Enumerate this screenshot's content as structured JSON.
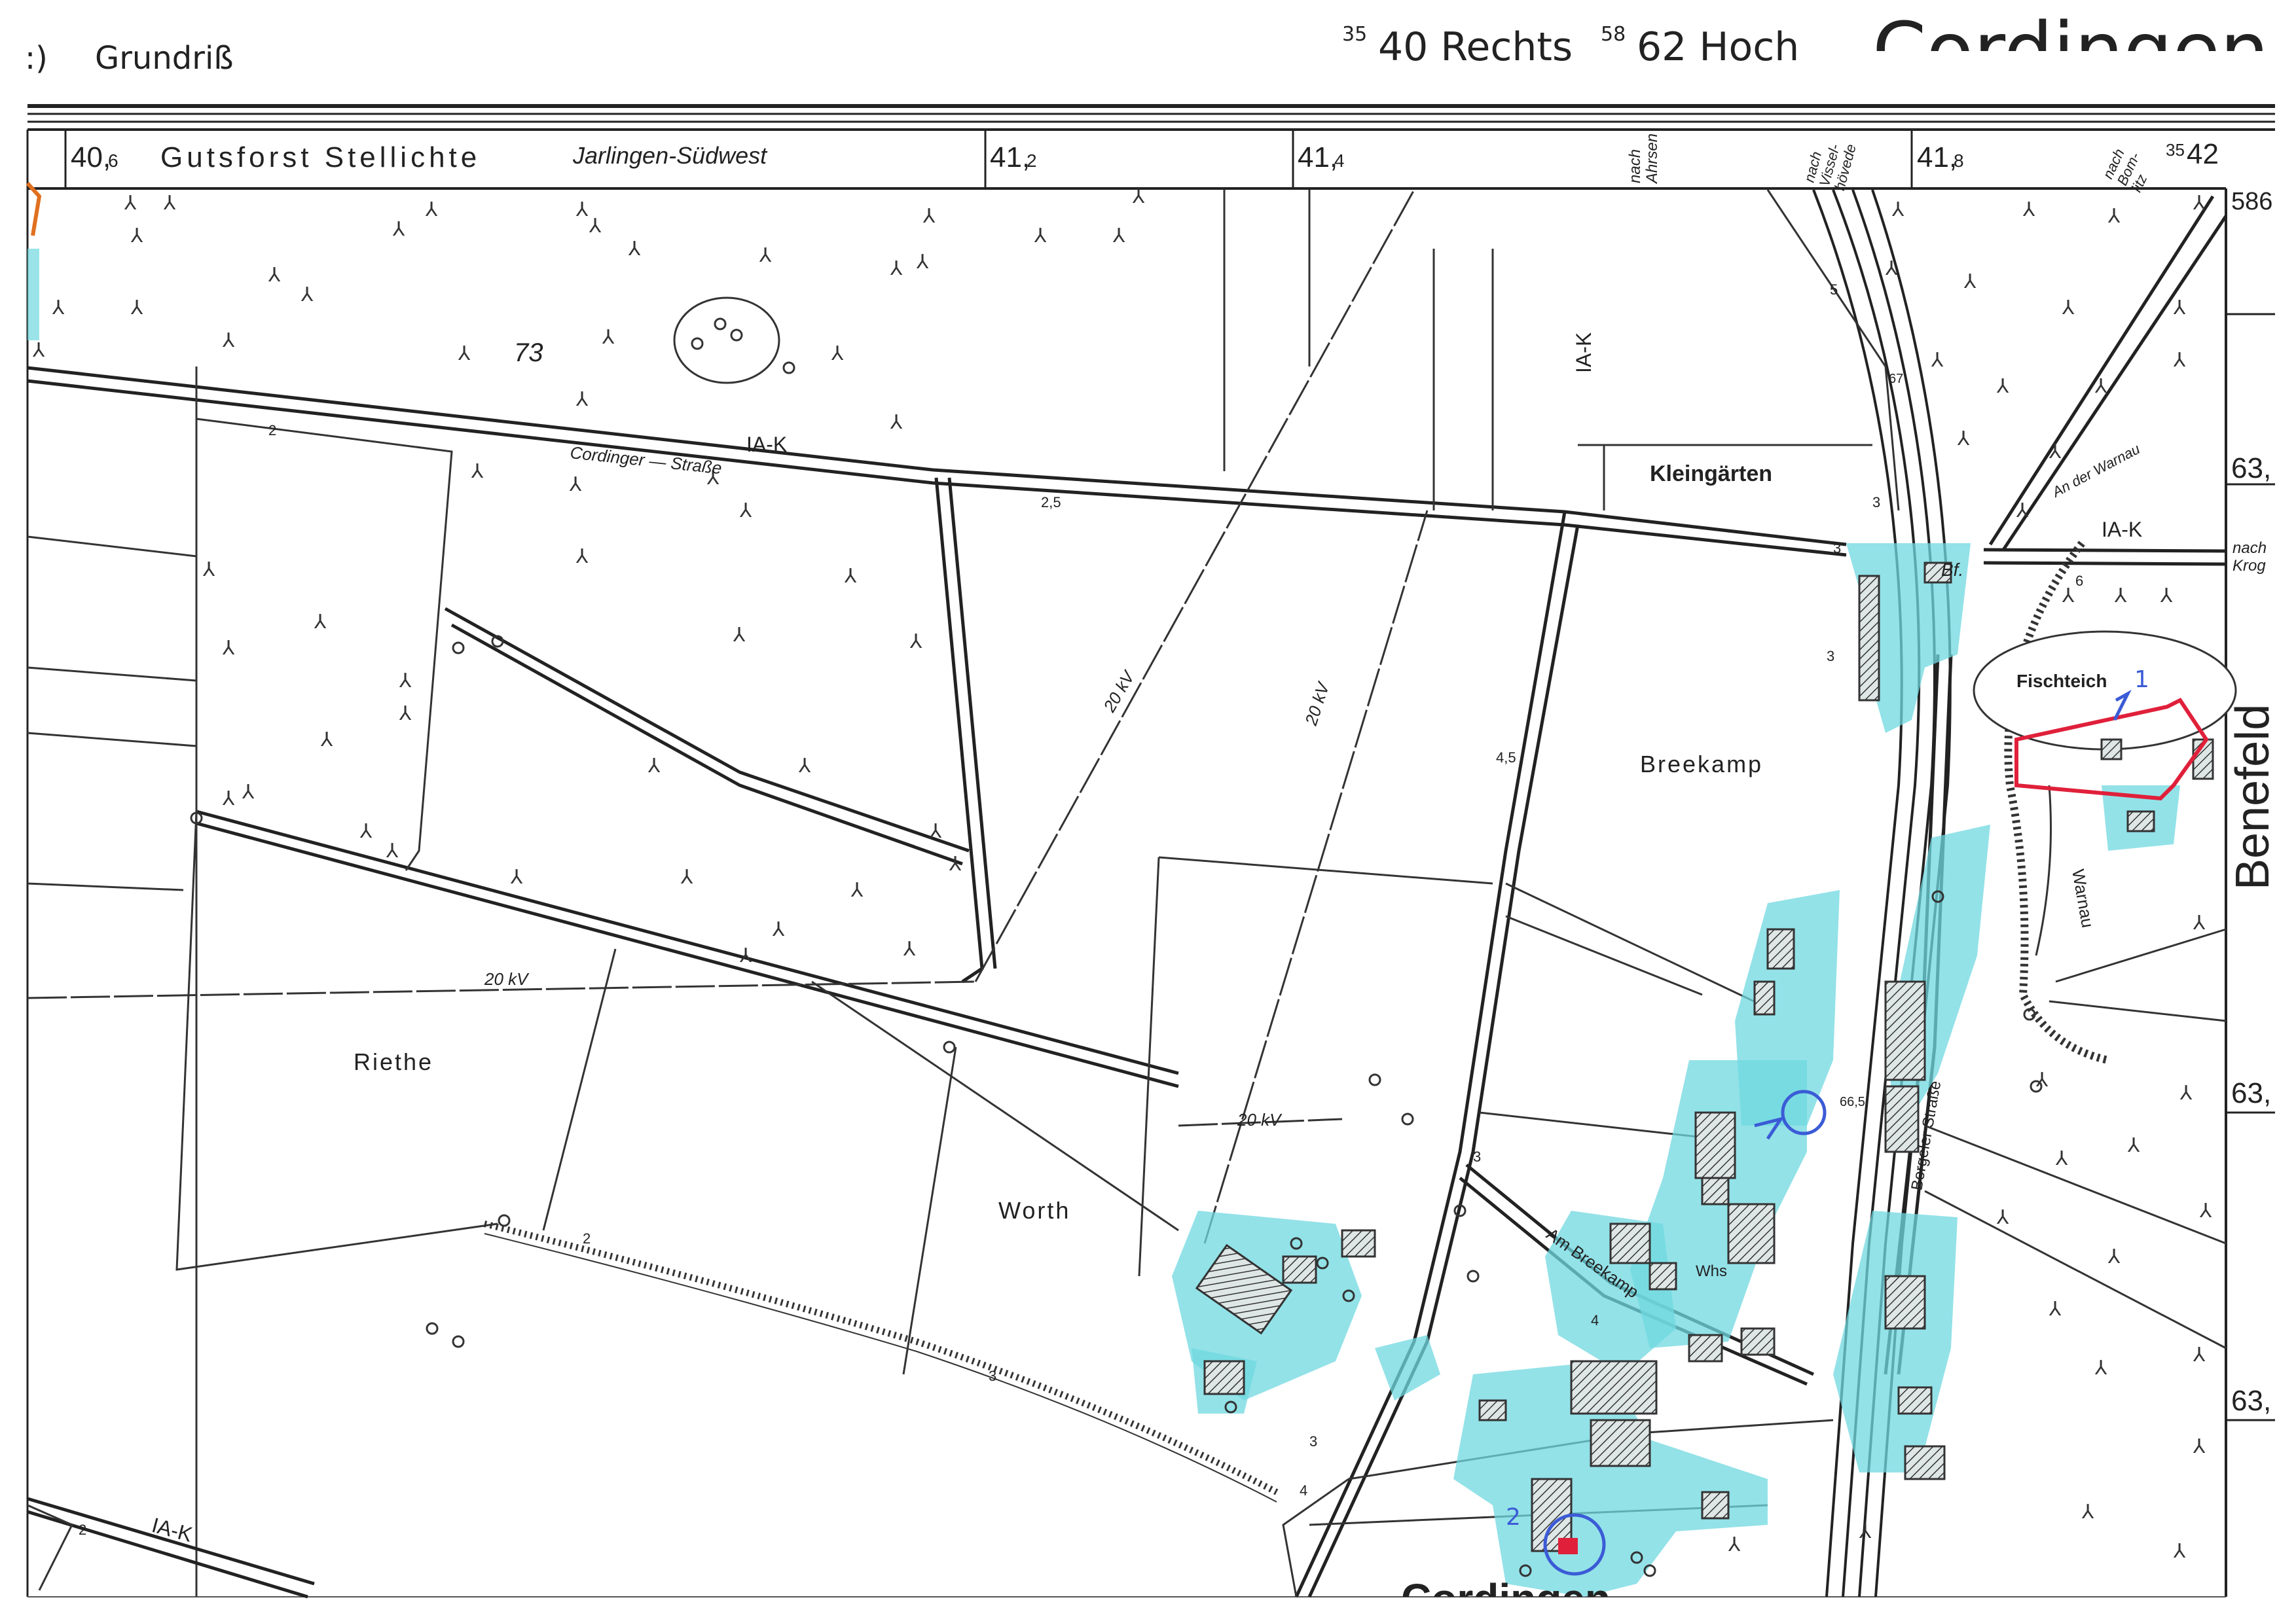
{
  "header": {
    "left_mark": ":)",
    "title": "Grundriß",
    "coord_prefix_1": "35",
    "coord_1": "40 Rechts",
    "coord_prefix_2": "58",
    "coord_2": "62 Hoch",
    "place_name_partial": "Cordingen"
  },
  "grid_labels": {
    "g1_main": "40,",
    "g1_sub": "6",
    "forest_name": "Gutsforst Stellichte",
    "sheet_area": "Jarlingen-Südwest",
    "g2_main": "41,",
    "g2_sub": "2",
    "g3_main": "41,",
    "g3_sub": "4",
    "g4_main": "41,",
    "g4_sub": "8",
    "g5_prefix": "35",
    "g5_main": "42",
    "right_top": "586",
    "right_1": "63,",
    "right_2": "63,",
    "right_3": "63,"
  },
  "direction_notes": {
    "nach_ahrsen": [
      "nach",
      "Ahrsen"
    ],
    "nach_visselhoevede": [
      "nach",
      "Vissel-",
      "hövede"
    ],
    "nach_bomlitz": [
      "nach",
      "Bom-",
      "litz"
    ],
    "nach_krog": [
      "nach",
      "Krog"
    ]
  },
  "place_labels": {
    "forest_number": "73",
    "kleingaerten": "Kleingärten",
    "breekamp": "Breekamp",
    "riethe": "Riethe",
    "worth": "Worth",
    "fischteich": "Fischteich",
    "benefeld": "Benefeld",
    "cordingen_bottom": "Cordingen",
    "bahnhof": "Bf.",
    "whs": "Whs"
  },
  "road_labels": {
    "cordinger_strasse": "Cordinger — Straße",
    "am_breekamp": "Am Breekamp",
    "borgeler_strasse": "Borgeler Straße",
    "an_der_warnau": "An der Warnau",
    "warnau": "Warnau"
  },
  "power_lines": {
    "label": "20 kV"
  },
  "road_class": {
    "label": "IA-K"
  },
  "misc_numbers": {
    "n2": "2",
    "n2_5": "2,5",
    "n3": "3",
    "n4": "4",
    "n4_5": "4,5",
    "n5": "5",
    "n6": "6",
    "n66_5": "66,5",
    "n67": "67",
    "handwritten_2": "2",
    "handwritten_1": "1"
  },
  "colors": {
    "highlight_cyan": "#6fd8e0",
    "parcel_red": "#e0203a",
    "pen_blue": "#3b5bd6",
    "line_dark": "#222222"
  }
}
